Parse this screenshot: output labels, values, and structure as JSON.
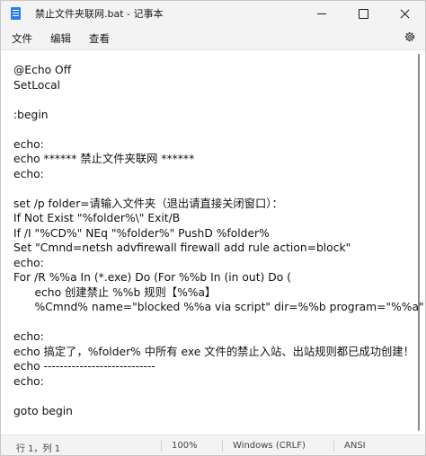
{
  "window": {
    "title": "禁止文件夹联网.bat - 记事本",
    "icon": "notepad-icon"
  },
  "menu": {
    "file": "文件",
    "edit": "编辑",
    "view": "查看",
    "settings_icon": "gear-icon"
  },
  "editor": {
    "lines": [
      "@Echo Off",
      "SetLocal",
      "",
      ":begin",
      "",
      "echo:",
      "echo ****** 禁止文件夹联网 ******",
      "echo:",
      "",
      "set /p folder=请输入文件夹（退出请直接关闭窗口）：",
      "If Not Exist \"%folder%\\\" Exit/B",
      "If /I \"%CD%\" NEq \"%folder%\" PushD %folder%",
      "Set \"Cmnd=netsh advfirewall firewall add rule action=block\"",
      "echo:",
      "For /R %%a In (*.exe) Do (For %%b In (in out) Do (",
      "      echo 创建禁止 %%b 规则【%%a】",
      "      %Cmnd% name=\"blocked %%a via script\" dir=%%b program=\"%%a\"))",
      "",
      "echo:",
      "echo 搞定了，%folder% 中所有 exe 文件的禁止入站、出站规则都已成功创建！",
      "echo ----------------------------",
      "echo:",
      "",
      "goto begin"
    ]
  },
  "status": {
    "position": "行 1，列 1",
    "zoom": "100%",
    "line_ending": "Windows (CRLF)",
    "encoding": "ANSI"
  }
}
